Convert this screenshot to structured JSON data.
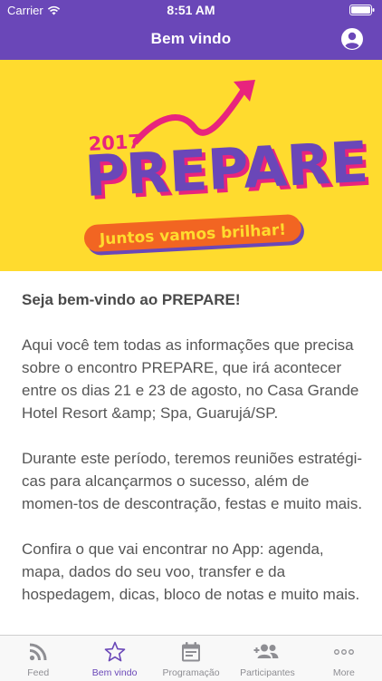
{
  "status_bar": {
    "carrier": "Carrier",
    "time": "8:51 AM"
  },
  "nav": {
    "title": "Bem vindo",
    "profile_icon": "account-circle-icon"
  },
  "banner": {
    "year": "2017",
    "title": "PREPARE",
    "tagline": "Juntos vamos brilhar!",
    "background_color": "#ffdb2e"
  },
  "content": {
    "heading": "Seja bem-vindo ao PREPARE!",
    "paragraphs": [
      "Aqui você tem todas as informações que precisa sobre o encontro PREPARE, que irá acontecer entre os dias 21 e 23 de agosto, no Casa Grande Hotel Resort &amp; Spa, Guarujá/SP.",
      "Durante este período, teremos reuniões estratégi-cas para alcançarmos o sucesso, além de momen-tos de descontração, festas e muito mais.",
      "Confira o que vai encontrar no App: agenda, mapa, dados do seu voo, transfer e da hospedagem, dicas, bloco de notas e muito mais."
    ]
  },
  "tabs": [
    {
      "label": "Feed",
      "icon": "rss-feed-icon",
      "active": false
    },
    {
      "label": "Bem vindo",
      "icon": "star-icon",
      "active": true
    },
    {
      "label": "Programação",
      "icon": "calendar-icon",
      "active": false
    },
    {
      "label": "Participantes",
      "icon": "add-people-icon",
      "active": false
    },
    {
      "label": "More",
      "icon": "more-dots-icon",
      "active": false
    }
  ],
  "colors": {
    "primary": "#6a47b8",
    "banner_yellow": "#ffdb2e",
    "accent_pink": "#e8247d",
    "accent_orange": "#f26522"
  }
}
